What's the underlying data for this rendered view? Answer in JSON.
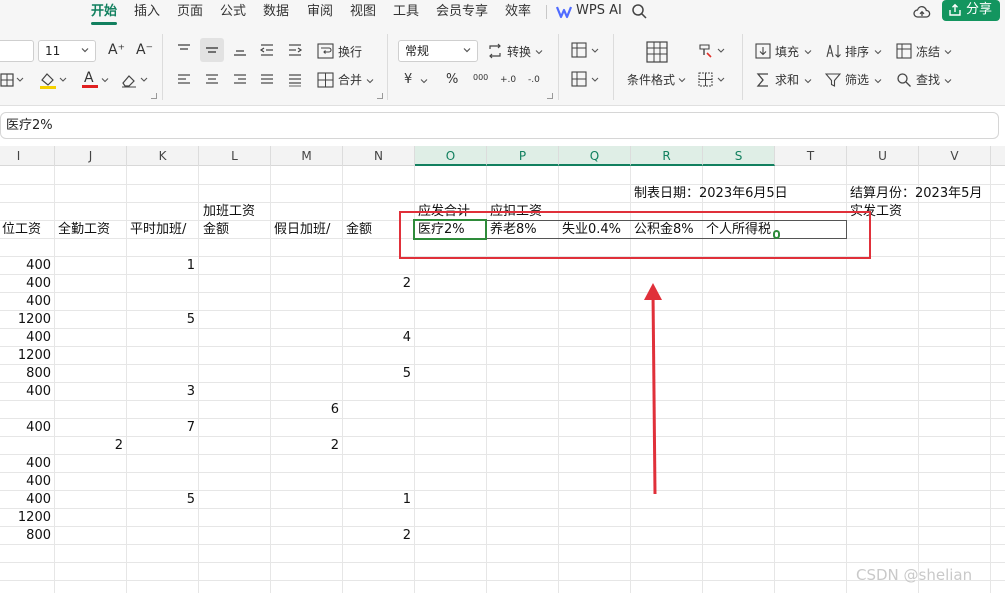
{
  "menu": {
    "tabs": [
      {
        "label": "开始",
        "active": true
      },
      {
        "label": "插入"
      },
      {
        "label": "页面"
      },
      {
        "label": "公式"
      },
      {
        "label": "数据"
      },
      {
        "label": "审阅"
      },
      {
        "label": "视图"
      },
      {
        "label": "工具"
      },
      {
        "label": "会员专享"
      },
      {
        "label": "效率"
      }
    ],
    "wps_ai_label": "WPS AI",
    "share_label": "分享",
    "accent": "#12805f",
    "share_bg": "#13955f"
  },
  "ribbon": {
    "font_size": "11",
    "number_format": "常规",
    "wrap_label": "换行",
    "merge_label": "合并",
    "convert_label": "转换",
    "conditional_format_label": "条件格式",
    "fill_label": "填充",
    "sort_label": "排序",
    "freeze_label": "冻结",
    "sum_label": "求和",
    "filter_label": "筛选",
    "find_label": "查找",
    "currency_symbol": "¥",
    "percent_symbol": "%",
    "thousands_symbol": "000",
    "dec_inc_symbol": "+.0",
    "dec_dec_symbol": "-.0",
    "font_grow_symbol": "A⁺",
    "font_shrink_symbol": "A⁻",
    "font_color_letter": "A"
  },
  "formula_bar": {
    "content": "医疗2%"
  },
  "grid": {
    "columns": [
      "I",
      "J",
      "K",
      "L",
      "M",
      "N",
      "O",
      "P",
      "Q",
      "R",
      "S",
      "T",
      "U",
      "V"
    ],
    "selected_columns": [
      "O",
      "P",
      "Q",
      "R",
      "S"
    ],
    "top_labels": {
      "date": "制表日期：2023年6月5日",
      "month": "结算月份：2023年5月"
    },
    "headers": {
      "I": "位工资",
      "J": "全勤工资",
      "K": "平时加班/",
      "L1": "加班工资",
      "L2": "金额",
      "M": "假日加班/",
      "N": "金额",
      "O": "应发合计",
      "P": "应扣工资",
      "U": "实发工资"
    },
    "deductions": [
      "医疗2%",
      "养老8%",
      "失业0.4%",
      "公积金8%",
      "个人所得税"
    ],
    "rows": [
      {
        "I": "400",
        "K": "1"
      },
      {
        "I": "400",
        "N": "2"
      },
      {
        "I": "400"
      },
      {
        "I": "1200",
        "K": "5"
      },
      {
        "I": "400",
        "N": "4"
      },
      {
        "I": "1200"
      },
      {
        "I": "800",
        "N": "5"
      },
      {
        "I": "400",
        "K": "3"
      },
      {
        "M": "6"
      },
      {
        "I": "400",
        "K": "7"
      },
      {
        "J": "2",
        "M": "2"
      },
      {
        "I": "400"
      },
      {
        "I": "400"
      },
      {
        "I": "400",
        "K": "5",
        "N": "1"
      },
      {
        "I": "1200"
      },
      {
        "I": "800",
        "N": "2"
      }
    ],
    "selection_color": "#2e8b3a",
    "annotation_color": "#e0303a"
  },
  "watermark": "CSDN @shelian"
}
